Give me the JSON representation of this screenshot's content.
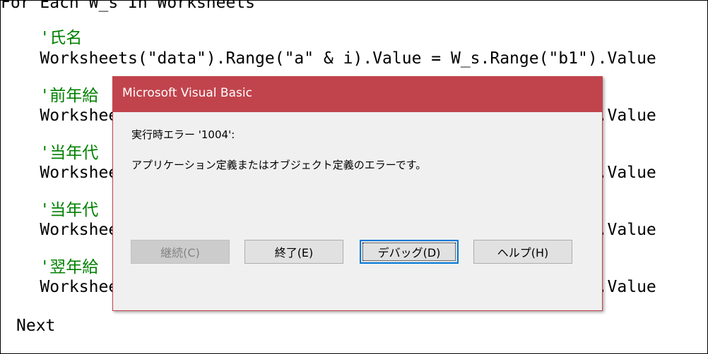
{
  "editor": {
    "lines": [
      {
        "text": "For Each W_s In Worksheets",
        "kind": "code"
      },
      {
        "text": "    '氏名",
        "kind": "comment"
      },
      {
        "text": "    Worksheets(\"data\").Range(\"a\" & i).Value = W_s.Range(\"b1\").Value",
        "kind": "code"
      },
      {
        "text": "    '前年給",
        "kind": "comment"
      },
      {
        "text": "    Worksheets(\"data\").Range(\"b\" & i).Value = W_s.Range(\"b3\").Value",
        "kind": "code"
      },
      {
        "text": "    '当年代",
        "kind": "comment"
      },
      {
        "text": "    Worksheets(\"data\").Range(\"c\" & i).Value = W_s.Range(\"b4\").Value",
        "kind": "code"
      },
      {
        "text": "    '当年代",
        "kind": "comment"
      },
      {
        "text": "    Worksheets(\"data\").Range(\"d\" & i).Value = W_s.Range(\"b5\").Value",
        "kind": "code"
      },
      {
        "text": "    '翌年給",
        "kind": "comment"
      },
      {
        "text": "    Worksheets(\"data\").Range(\"e\" & i).Value = W_s.Range(\"b8\").Value",
        "kind": "code"
      },
      {
        "text": "Next",
        "kind": "code"
      }
    ]
  },
  "dialog": {
    "title": "Microsoft Visual Basic",
    "error_line": "実行時エラー '1004':",
    "message": "アプリケーション定義またはオブジェクト定義のエラーです。",
    "buttons": {
      "continue": "継続(C)",
      "end": "終了(E)",
      "debug": "デバッグ(D)",
      "help": "ヘルプ(H)"
    }
  },
  "colors": {
    "titlebar": "#c1444d",
    "comment": "#008000",
    "focus": "#0078d7"
  }
}
